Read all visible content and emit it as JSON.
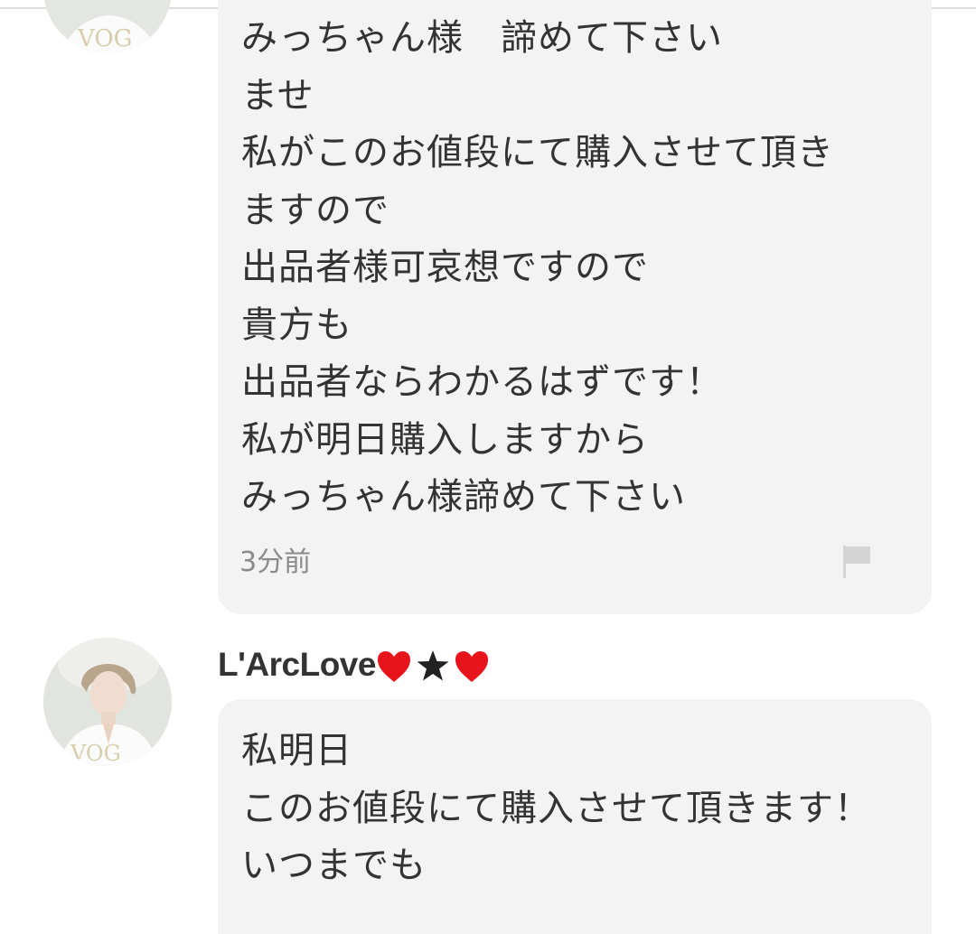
{
  "comments": [
    {
      "lines": [
        "みっちゃん様　諦めて下さい",
        "ませ",
        "私がこのお値段にて購入させて頂き",
        "ますので",
        "出品者様可哀想ですので",
        "貴方も",
        "出品者ならわかるはずです！",
        "私が明日購入しますから",
        "みっちゃん様諦めて下さい"
      ],
      "timestamp": "3分前",
      "report_icon": "flag-icon"
    },
    {
      "username": "L'ArcLove",
      "username_decorations": [
        "heart-icon",
        "star-icon",
        "heart-icon"
      ],
      "lines": [
        "私明日",
        "このお値段にて購入させて頂きます！",
        "いつまでも"
      ]
    }
  ],
  "colors": {
    "bubble": "#f3f3f3",
    "text": "#333333",
    "timestamp": "#8a8a8a",
    "heart": "#e8141c",
    "star": "#222222",
    "flag": "#d4d4d4"
  }
}
